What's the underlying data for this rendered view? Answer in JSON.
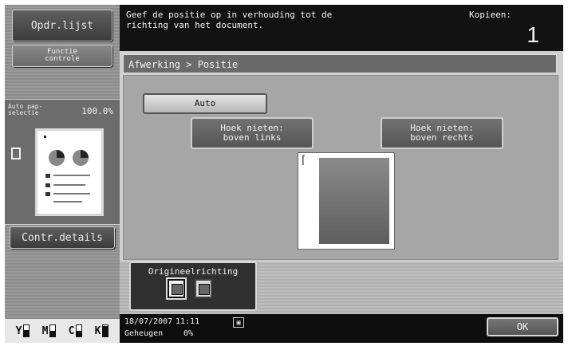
{
  "left": {
    "job_list_label": "Opdr.lijst",
    "check_label_line1": "Functie",
    "check_label_line2": "controle",
    "zoom_label": "Auto pap-selectie",
    "zoom_value": "100.0%",
    "details_label": "Contr.details",
    "toner": [
      {
        "letter": "Y",
        "level": 0.6
      },
      {
        "letter": "M",
        "level": 0.5
      },
      {
        "letter": "C",
        "level": 0.5
      },
      {
        "letter": "K",
        "level": 0.9
      }
    ]
  },
  "message": {
    "line1": "Geef de positie op in verhouding tot de",
    "line2": "richting van het document.",
    "copies_label": "Kopieen:",
    "copies_value": "1"
  },
  "main": {
    "breadcrumb": "Afwerking > Positie",
    "auto_label": "Auto",
    "top_left_line1": "Hoek nieten:",
    "top_left_line2": "boven links",
    "top_right_line1": "Hoek nieten:",
    "top_right_line2": "boven rechts",
    "orientation_label": "Origineelrichting"
  },
  "status": {
    "date": "18/07/2007",
    "time": "11:11",
    "memory_label": "Geheugen",
    "memory_value": "0%",
    "ok_label": "OK"
  },
  "icons": {
    "staple": "staple-corner-icon",
    "portrait": "portrait-orientation-icon",
    "landscape": "landscape-orientation-icon",
    "page": "page-icon"
  }
}
